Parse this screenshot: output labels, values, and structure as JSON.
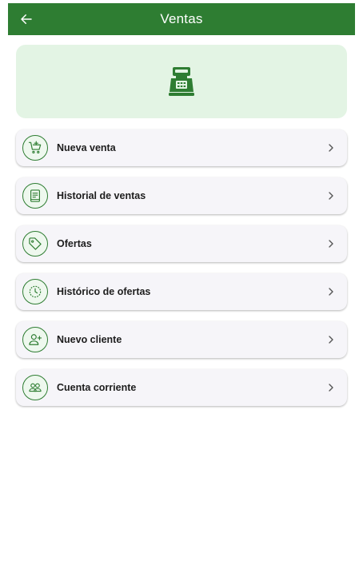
{
  "app_bar": {
    "title": "Ventas",
    "background": "#2e7d32",
    "back_icon": "arrow-left-icon"
  },
  "banner": {
    "icon": "cash-register-icon",
    "background": "#e3f4e4"
  },
  "menu": {
    "items": [
      {
        "label": "Nueva venta",
        "icon": "cart-plus-icon"
      },
      {
        "label": "Historial de ventas",
        "icon": "receipt-icon"
      },
      {
        "label": "Ofertas",
        "icon": "tag-icon"
      },
      {
        "label": "Histórico de ofertas",
        "icon": "clock-history-icon"
      },
      {
        "label": "Nuevo cliente",
        "icon": "person-add-icon"
      },
      {
        "label": "Cuenta corriente",
        "icon": "people-icon"
      }
    ],
    "chevron_icon": "chevron-right-icon",
    "accent": "#2e7d32"
  }
}
